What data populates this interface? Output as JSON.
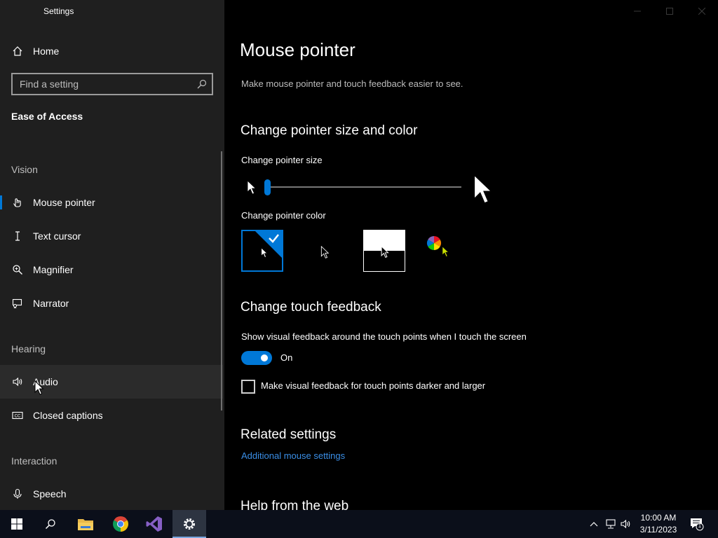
{
  "app": {
    "title": "Settings"
  },
  "sidebar": {
    "home_label": "Home",
    "search": {
      "placeholder": "Find a setting"
    },
    "section": "Ease of Access",
    "groups": {
      "vision": "Vision",
      "hearing": "Hearing",
      "interaction": "Interaction"
    },
    "items": [
      {
        "label": "Mouse pointer",
        "icon": "mouse-pointer-icon",
        "selected": true
      },
      {
        "label": "Text cursor",
        "icon": "text-cursor-icon"
      },
      {
        "label": "Magnifier",
        "icon": "magnifier-icon"
      },
      {
        "label": "Narrator",
        "icon": "narrator-icon"
      },
      {
        "label": "Audio",
        "icon": "speaker-icon",
        "hovered": true
      },
      {
        "label": "Closed captions",
        "icon": "closed-captions-icon"
      },
      {
        "label": "Speech",
        "icon": "microphone-icon"
      }
    ]
  },
  "main": {
    "title": "Mouse pointer",
    "description": "Make mouse pointer and touch feedback easier to see.",
    "pointer_section": {
      "heading": "Change pointer size and color",
      "size_label": "Change pointer size",
      "size_level": 0.02,
      "color_label": "Change pointer color",
      "color_options": [
        "white",
        "black",
        "inverted",
        "custom"
      ],
      "selected_color": "white"
    },
    "touch_section": {
      "heading": "Change touch feedback",
      "feedback_label": "Show visual feedback around the touch points when I touch the screen",
      "toggle_state": "On",
      "darker_label": "Make visual feedback for touch points darker and larger",
      "darker_checked": false
    },
    "related": {
      "heading": "Related settings",
      "link": "Additional mouse settings"
    },
    "help": {
      "heading": "Help from the web"
    }
  },
  "taskbar": {
    "apps": [
      "start",
      "search",
      "file-explorer",
      "chrome",
      "visual-studio",
      "settings"
    ],
    "active_app": "settings",
    "time": "10:00 AM",
    "date": "3/11/2023",
    "notification_count": "1"
  },
  "colors": {
    "accent": "#0078d7",
    "sidebar_bg": "#1f1f1f",
    "main_bg": "#000000",
    "link": "#3a8ee6",
    "custom_pointer": "#c8e000"
  }
}
